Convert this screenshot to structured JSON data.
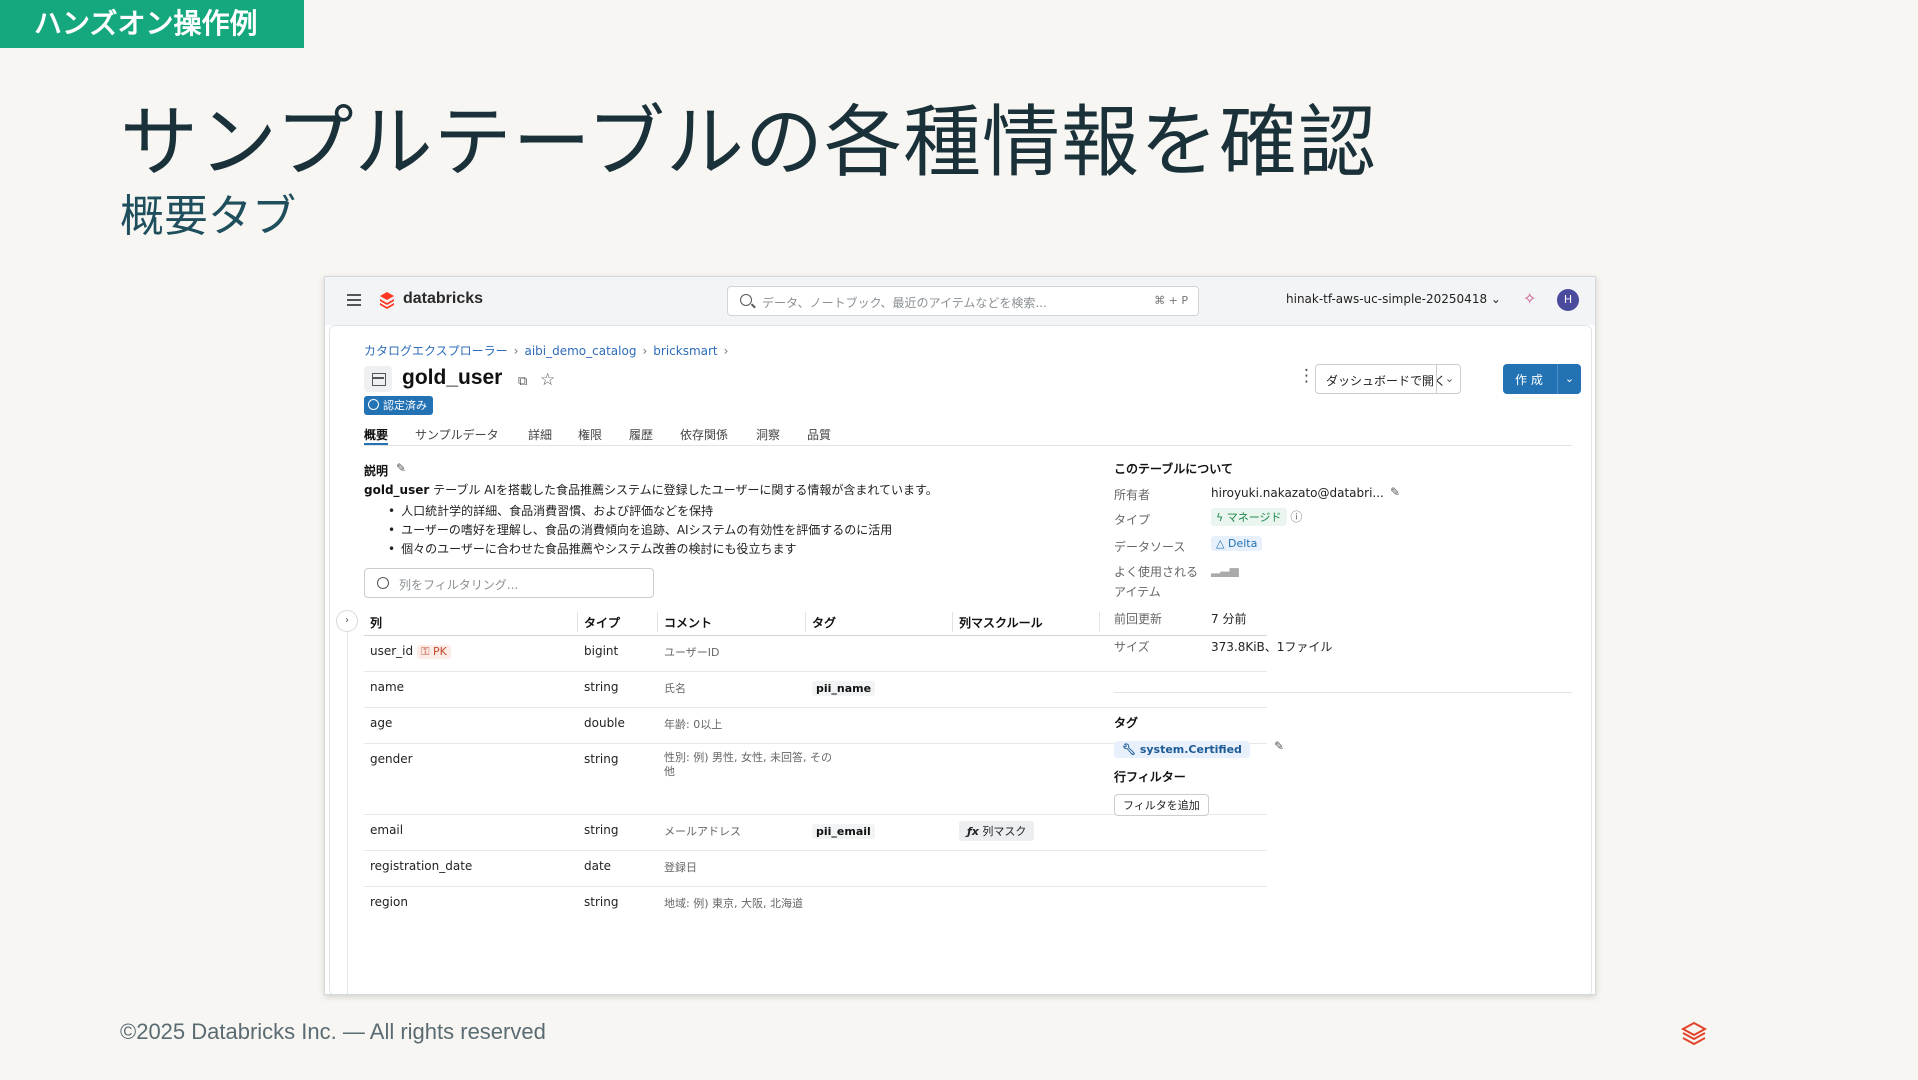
{
  "slide": {
    "tag": "ハンズオン操作例",
    "title": "サンプルテーブルの各種情報を確認",
    "subtitle": "概要タブ",
    "footer": "©2025 Databricks Inc. — All rights reserved"
  },
  "topbar": {
    "brand": "databricks",
    "search_placeholder": "データ、ノートブック、最近のアイテムなどを検索...",
    "search_shortcut": "⌘ + P",
    "workspace": "hinak-tf-aws-uc-simple-20250418",
    "avatar": "H"
  },
  "breadcrumb": [
    "カタログエクスプローラー",
    "aibi_demo_catalog",
    "bricksmart"
  ],
  "header": {
    "table_name": "gold_user",
    "badge": "認定済み",
    "dashboard_button": "ダッシュボードで開く",
    "create_button": "作 成"
  },
  "tabs": [
    "概要",
    "サンプルデータ",
    "詳細",
    "権限",
    "履歴",
    "依存関係",
    "洞察",
    "品質"
  ],
  "description": {
    "label": "説明",
    "table": "gold_user",
    "text": " テーブル AIを搭載した食品推薦システムに登録したユーザーに関する情報が含まれています。",
    "bullets": [
      "人口統計学的詳細、食品消費習慣、および評価などを保持",
      "ユーザーの嗜好を理解し、食品の消費傾向を追跡、AIシステムの有効性を評価するのに活用",
      "個々のユーザーに合わせた食品推薦やシステム改善の検討にも役立ちます"
    ]
  },
  "filter_placeholder": "列をフィルタリング...",
  "columns_table": {
    "headers": [
      "列",
      "タイプ",
      "コメント",
      "タグ",
      "列マスクルール"
    ],
    "rows": [
      {
        "name": "user_id",
        "pk": "PK",
        "type": "bigint",
        "comment": "ユーザーID",
        "tag": "",
        "mask": ""
      },
      {
        "name": "name",
        "pk": "",
        "type": "string",
        "comment": "氏名",
        "tag": "pii_name",
        "mask": ""
      },
      {
        "name": "age",
        "pk": "",
        "type": "double",
        "comment": "年齢: 0以上",
        "tag": "",
        "mask": ""
      },
      {
        "name": "gender",
        "pk": "",
        "type": "string",
        "comment": "性別: 例) 男性, 女性, 未回答, その他",
        "tag": "",
        "mask": ""
      },
      {
        "name": "email",
        "pk": "",
        "type": "string",
        "comment": "メールアドレス",
        "tag": "pii_email",
        "mask": "列マスク"
      },
      {
        "name": "registration_date",
        "pk": "",
        "type": "date",
        "comment": "登録日",
        "tag": "",
        "mask": ""
      },
      {
        "name": "region",
        "pk": "",
        "type": "string",
        "comment": "地域: 例) 東京, 大阪, 北海道",
        "tag": "",
        "mask": ""
      }
    ]
  },
  "about": {
    "title": "このテーブルについて",
    "owner_label": "所有者",
    "owner": "hiroyuki.nakazato@databri...",
    "type_label": "タイプ",
    "type": "マネージド",
    "source_label": "データソース",
    "source": "Delta",
    "popular_label_1": "よく使用される",
    "popular_label_2": "アイテム",
    "updated_label": "前回更新",
    "updated": "7 分前",
    "size_label": "サイズ",
    "size": "373.8KiB、1ファイル",
    "tags_title": "タグ",
    "tag": "system.Certified",
    "row_filter_title": "行フィルター",
    "add_filter": "フィルタを追加"
  },
  "colors": {
    "accent": "#2272b4",
    "hands_on": "#15a87e",
    "title": "#1b3139"
  }
}
